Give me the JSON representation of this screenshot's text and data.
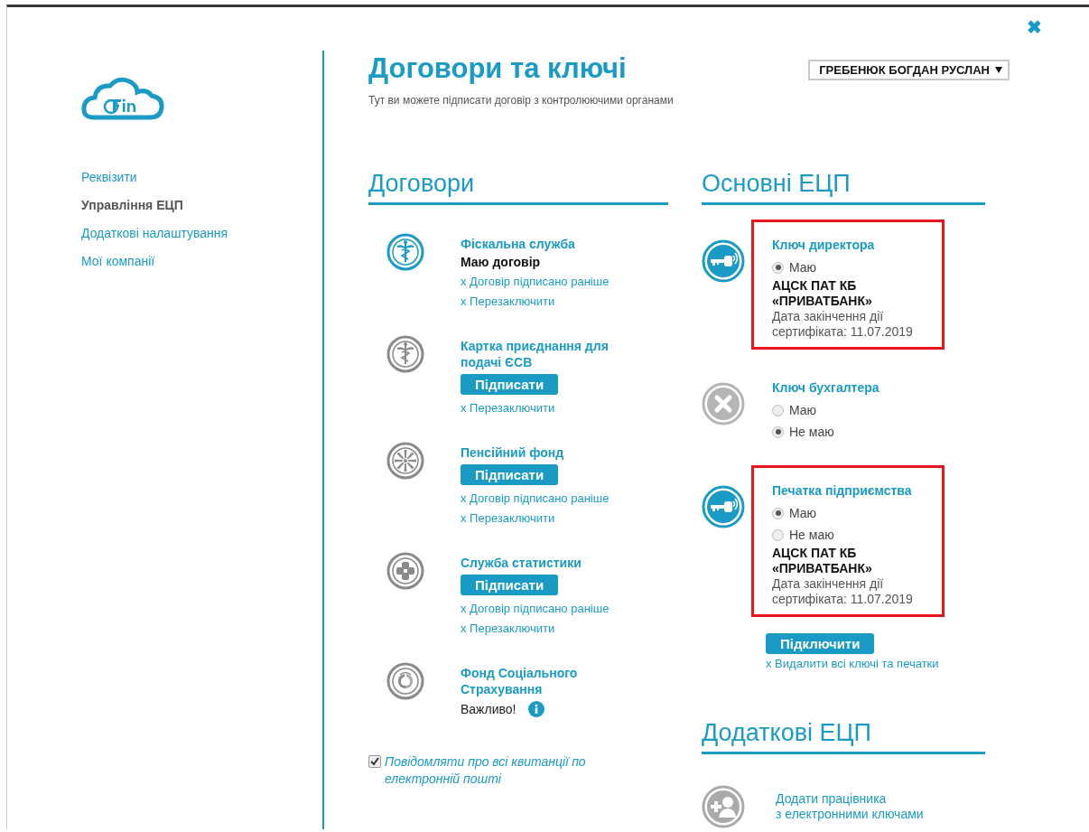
{
  "close": "✖",
  "sidebar": {
    "items": [
      {
        "label": "Реквізити",
        "selected": false
      },
      {
        "label": "Управління ЕЦП",
        "selected": true
      },
      {
        "label": "Додаткові налаштування",
        "selected": false
      },
      {
        "label": "Мої компанії",
        "selected": false
      }
    ]
  },
  "header": {
    "title": "Договори та ключі",
    "subtitle": "Тут ви можете підписати договір з контролюючими органами",
    "user_select": "ГРЕБЕНЮК БОГДАН РУСЛАН"
  },
  "contracts": {
    "heading": "Договори",
    "items": [
      {
        "kind": "caduceus",
        "active": true,
        "title": "Фіскальна служба",
        "status": "Маю договір",
        "links": [
          "x Договір підписано раніше",
          "x Перезаключити"
        ]
      },
      {
        "kind": "caduceus",
        "active": false,
        "title": "Картка приєднання для подачі ЄСВ",
        "button": "Підписати",
        "links": [
          "x Перезаключити"
        ]
      },
      {
        "kind": "snowflake",
        "active": false,
        "title": "Пенсійний фонд",
        "button": "Підписати",
        "links": [
          "x Договір підписано раніше",
          "x Перезаключити"
        ]
      },
      {
        "kind": "cross",
        "active": false,
        "title": "Служба статистики",
        "button": "Підписати",
        "links": [
          "x Договір підписано раніше",
          "x Перезаключити"
        ]
      },
      {
        "kind": "fss",
        "active": false,
        "title": "Фонд Соціального Страхування",
        "note": "Важливо!"
      }
    ],
    "email_notify": {
      "label": "Повідомляти про всі квитанції по електронній пошті",
      "checked": true
    }
  },
  "keys": {
    "heading": "Основні ЕЦП",
    "items": [
      {
        "kind": "key",
        "highlighted": true,
        "title": "Ключ директора",
        "options": [
          {
            "label": "Маю",
            "selected": true
          }
        ],
        "issuer": "АЦСК ПАТ КБ «ПРИВАТБАНК»",
        "expiry": "Дата закінчення дії сертифіката: 11.07.2019"
      },
      {
        "kind": "none",
        "highlighted": false,
        "title": "Ключ бухгалтера",
        "options": [
          {
            "label": "Маю",
            "selected": false
          },
          {
            "label": "Не маю",
            "selected": true
          }
        ]
      },
      {
        "kind": "key",
        "highlighted": true,
        "title": "Печатка підприємства",
        "options": [
          {
            "label": "Маю",
            "selected": true
          },
          {
            "label": "Не маю",
            "selected": false
          }
        ],
        "issuer": "АЦСК ПАТ КБ «ПРИВАТБАНК»",
        "expiry": "Дата закінчення дії сертифіката: 11.07.2019"
      }
    ],
    "button": "Підключити",
    "remove_link": "x Видалити всі ключі та печатки"
  },
  "additional": {
    "heading": "Додаткові ЕЦП",
    "add_link": "Додати працівника\nз електронними ключами"
  }
}
